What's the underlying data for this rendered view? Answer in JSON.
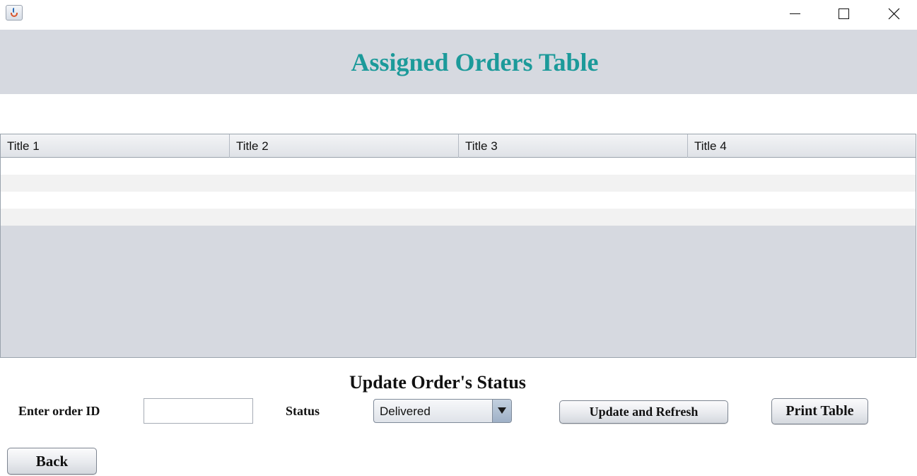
{
  "window": {
    "app_icon": "java-cup-icon",
    "controls": [
      "minimize-icon",
      "maximize-icon",
      "close-icon"
    ]
  },
  "header": {
    "title": "Assigned Orders Table",
    "title_color": "#1c9a9a",
    "band_color": "#d6d9e0"
  },
  "table": {
    "columns": [
      "Title 1",
      "Title 2",
      "Title 3",
      "Title 4"
    ],
    "rows": [
      [
        "",
        "",
        "",
        ""
      ],
      [
        "",
        "",
        "",
        ""
      ],
      [
        "",
        "",
        "",
        ""
      ],
      [
        "",
        "",
        "",
        ""
      ]
    ]
  },
  "update_section": {
    "title": "Update Order's Status",
    "order_id_label": "Enter order ID",
    "order_id_value": "",
    "status_label": "Status",
    "status_selected": "Delivered",
    "update_button": "Update and Refresh",
    "print_button": "Print Table"
  },
  "footer": {
    "back_button": "Back"
  }
}
